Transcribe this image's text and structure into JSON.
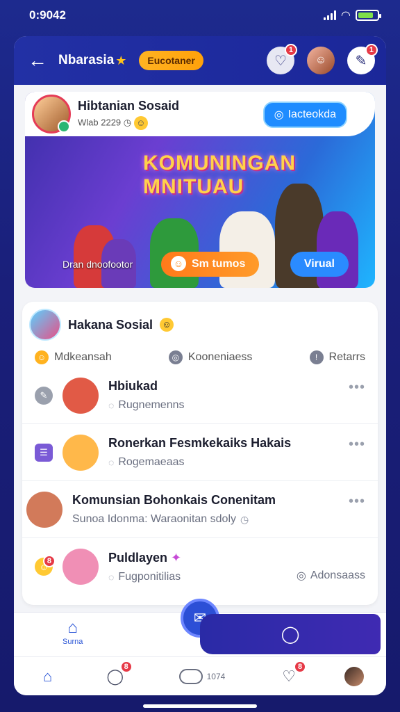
{
  "status": {
    "time": "0:9042"
  },
  "header": {
    "title": "Nbarasia",
    "pill_label": "Eucotaner",
    "icon1_badge": "1",
    "icon3_badge": "1"
  },
  "hero": {
    "name": "Hibtanian Sosaid",
    "meta": "Wlab 2229",
    "tag": "Iacteokda",
    "headline_1": "KOMUNINGAN",
    "headline_2": "MNITUAU",
    "caption": "Dran dnoofootor",
    "button_primary": "Sm tumos",
    "button_secondary": "Virual"
  },
  "card": {
    "title": "Hakana Sosial",
    "filters": [
      {
        "label": "Mdkeansah",
        "icon": "emoji-icon",
        "color": "#ffb21f"
      },
      {
        "label": "Kooneniaess",
        "icon": "compass-icon",
        "color": "#7a7f92"
      },
      {
        "label": "Retarrs",
        "icon": "info-icon",
        "color": "#7a7f92"
      }
    ],
    "rows": [
      {
        "title": "Hbiukad",
        "sub": "Rugnemenns",
        "lead_color": "#9aa0ad",
        "avatar_color": "#e15a46"
      },
      {
        "title": "Ronerkan Fesmkekaiks Hakais",
        "sub": "Rogemaeaas",
        "lead_color": "#7a5ad6",
        "avatar_color": "#ffb84a"
      },
      {
        "title": "Komunsian Bohonkais Conenitam",
        "sub": "Sunoa Idonma: Waraonitan sdoly",
        "lead_color": "",
        "avatar_color": "#d27a5a"
      },
      {
        "title": "Puldlayen",
        "sub": "Fugponitilias",
        "right": "Adonsaass",
        "lead_color": "#ffc933",
        "avatar_color": "#f08fb5",
        "lead_badge": "8"
      }
    ]
  },
  "tabbar": {
    "home_label": "Surna",
    "nav_badge_1": "8",
    "nav_badge_2": "8",
    "nav_text": "1074"
  }
}
